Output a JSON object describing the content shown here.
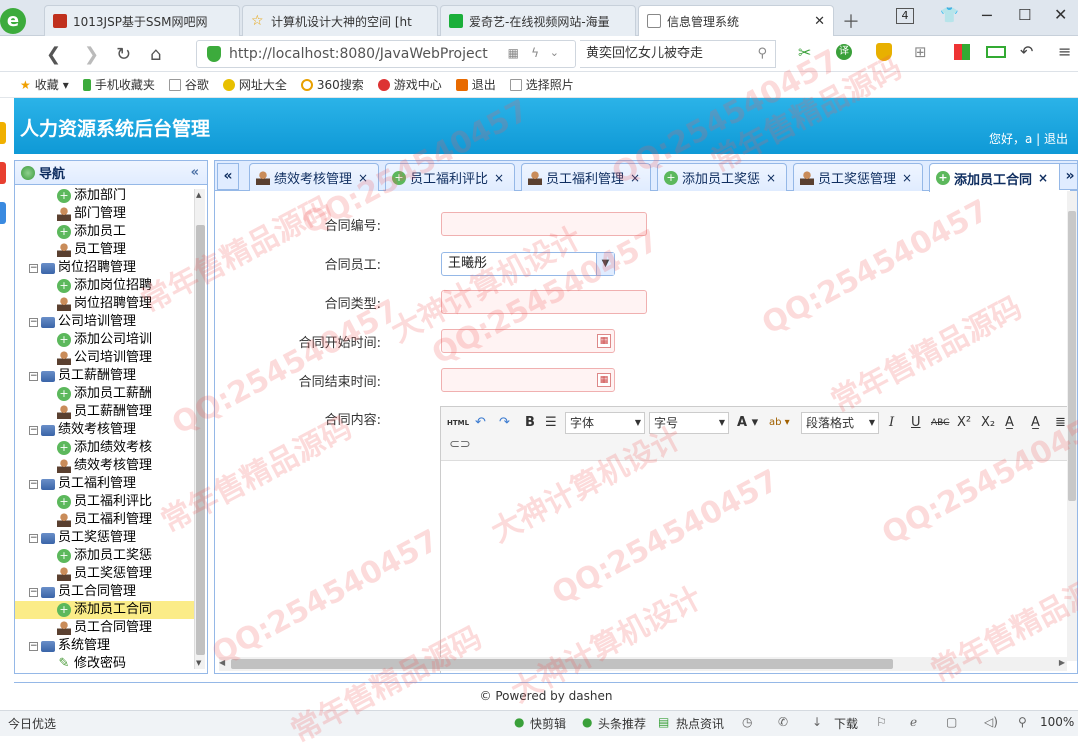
{
  "browser": {
    "tabs": [
      {
        "title": "1013JSP基于SSM网吧网"
      },
      {
        "title": "计算机设计大神的空间 [ht"
      },
      {
        "title": "爱奇艺-在线视频网站-海量"
      },
      {
        "title": "信息管理系统"
      }
    ],
    "tab_count": "4",
    "url": "http://localhost:8080/JavaWebProject",
    "search_text": "黄奕回忆女儿被夺走",
    "bookmarks": [
      "收藏",
      "手机收藏夹",
      "谷歌",
      "网址大全",
      "360搜索",
      "游戏中心",
      "退出",
      "选择照片"
    ]
  },
  "app": {
    "title": "人力资源系统后台管理",
    "user_greeting": "您好，a",
    "logout": "退出",
    "nav_title": "导航",
    "footer": "© Powered by dashen"
  },
  "tree": [
    {
      "label": "添加部门",
      "icon": "add",
      "level": 2
    },
    {
      "label": "部门管理",
      "icon": "user",
      "level": 2
    },
    {
      "label": "添加员工",
      "icon": "add",
      "level": 2
    },
    {
      "label": "员工管理",
      "icon": "user",
      "level": 2
    },
    {
      "label": "岗位招聘管理",
      "icon": "pc",
      "level": 1
    },
    {
      "label": "添加岗位招聘",
      "icon": "add",
      "level": 2
    },
    {
      "label": "岗位招聘管理",
      "icon": "user",
      "level": 2
    },
    {
      "label": "公司培训管理",
      "icon": "pc",
      "level": 1
    },
    {
      "label": "添加公司培训",
      "icon": "add",
      "level": 2
    },
    {
      "label": "公司培训管理",
      "icon": "user",
      "level": 2
    },
    {
      "label": "员工薪酬管理",
      "icon": "pc",
      "level": 1
    },
    {
      "label": "添加员工薪酬",
      "icon": "add",
      "level": 2
    },
    {
      "label": "员工薪酬管理",
      "icon": "user",
      "level": 2
    },
    {
      "label": "绩效考核管理",
      "icon": "pc",
      "level": 1
    },
    {
      "label": "添加绩效考核",
      "icon": "add",
      "level": 2
    },
    {
      "label": "绩效考核管理",
      "icon": "user",
      "level": 2
    },
    {
      "label": "员工福利管理",
      "icon": "pc",
      "level": 1
    },
    {
      "label": "员工福利评比",
      "icon": "add",
      "level": 2
    },
    {
      "label": "员工福利管理",
      "icon": "user",
      "level": 2
    },
    {
      "label": "员工奖惩管理",
      "icon": "pc",
      "level": 1
    },
    {
      "label": "添加员工奖惩",
      "icon": "add",
      "level": 2
    },
    {
      "label": "员工奖惩管理",
      "icon": "user",
      "level": 2
    },
    {
      "label": "员工合同管理",
      "icon": "pc",
      "level": 1
    },
    {
      "label": "添加员工合同",
      "icon": "add",
      "level": 2,
      "selected": true
    },
    {
      "label": "员工合同管理",
      "icon": "user",
      "level": 2
    },
    {
      "label": "系统管理",
      "icon": "pc",
      "level": 1
    },
    {
      "label": "修改密码",
      "icon": "pen",
      "level": 2
    }
  ],
  "app_tabs": [
    {
      "label": "绩效考核管理",
      "icon": "user"
    },
    {
      "label": "员工福利评比",
      "icon": "add"
    },
    {
      "label": "员工福利管理",
      "icon": "user"
    },
    {
      "label": "添加员工奖惩",
      "icon": "add"
    },
    {
      "label": "员工奖惩管理",
      "icon": "user"
    },
    {
      "label": "添加员工合同",
      "icon": "add",
      "active": true
    }
  ],
  "form": {
    "contract_no_label": "合同编号:",
    "employee_label": "合同员工:",
    "employee_value": "王曦彤",
    "type_label": "合同类型:",
    "start_label": "合同开始时间:",
    "end_label": "合同结束时间:",
    "content_label": "合同内容:"
  },
  "editor": {
    "html_btn": "HTML",
    "font_label": "字体",
    "size_label": "字号",
    "format_label": "段落格式"
  },
  "statusbar": {
    "left": "今日优选",
    "items": [
      "快剪辑",
      "头条推荐",
      "热点资讯",
      "下载"
    ],
    "zoom": "100%"
  },
  "watermarks": [
    "QQ:254540457",
    "大神计算机设计",
    "常年售精品源码"
  ]
}
